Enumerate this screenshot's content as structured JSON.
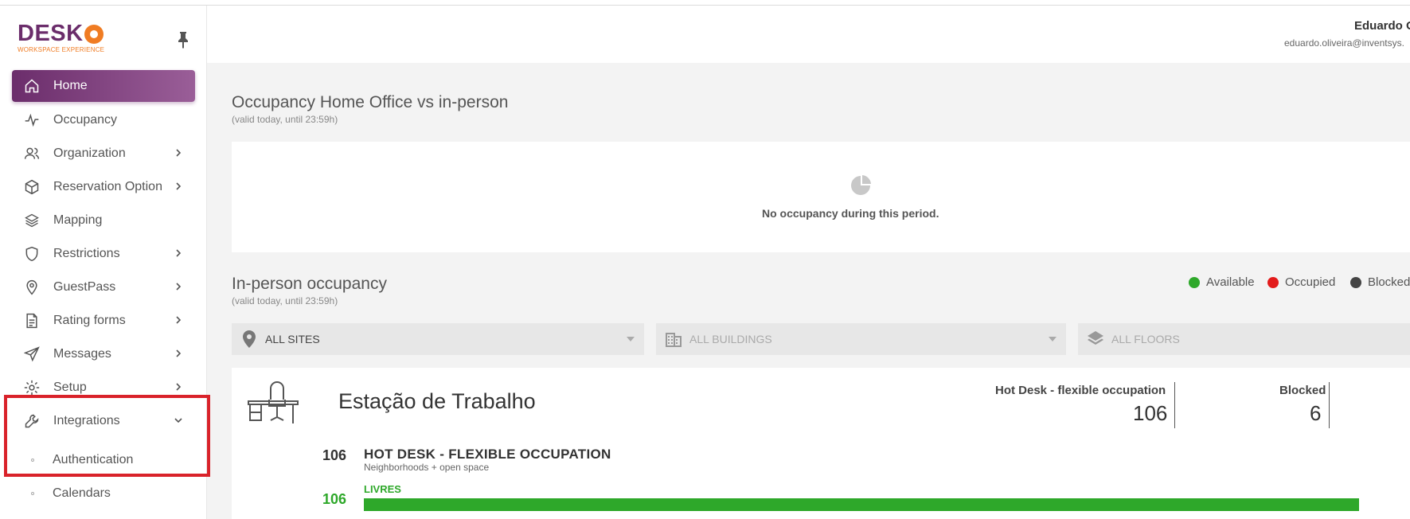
{
  "brand": {
    "name": "DESK",
    "tagline": "WORKSPACE EXPERIENCE",
    "primary": "#6b2d6b",
    "accent": "#f07c23"
  },
  "sidebar": {
    "items": [
      {
        "label": "Home",
        "icon": "home-icon",
        "active": true,
        "chevron": false
      },
      {
        "label": "Occupancy",
        "icon": "pulse-icon",
        "chevron": false
      },
      {
        "label": "Organization",
        "icon": "users-icon",
        "chevron": true
      },
      {
        "label": "Reservation Option",
        "icon": "cube-icon",
        "chevron": true
      },
      {
        "label": "Mapping",
        "icon": "layers-icon",
        "chevron": false
      },
      {
        "label": "Restrictions",
        "icon": "shield-icon",
        "chevron": true
      },
      {
        "label": "GuestPass",
        "icon": "location-pin-icon",
        "chevron": true
      },
      {
        "label": "Rating forms",
        "icon": "document-icon",
        "chevron": true
      },
      {
        "label": "Messages",
        "icon": "send-icon",
        "chevron": true
      },
      {
        "label": "Setup",
        "icon": "gear-icon",
        "chevron": true
      },
      {
        "label": "Integrations",
        "icon": "wrench-icon",
        "chevron": true,
        "expanded": true
      }
    ],
    "subitems": [
      {
        "label": "Authentication"
      },
      {
        "label": "Calendars"
      }
    ]
  },
  "header": {
    "user_name": "Eduardo O",
    "user_email": "eduardo.oliveira@inventsys."
  },
  "occupancy_section": {
    "title": "Occupancy Home Office vs in-person",
    "subtitle": "(valid today, until 23:59h)",
    "empty_message": "No occupancy during this period."
  },
  "inperson_section": {
    "title": "In-person occupancy",
    "subtitle": "(valid today, until 23:59h)",
    "legend": [
      {
        "label": "Available",
        "color": "#2ea82a"
      },
      {
        "label": "Occupied",
        "color": "#e31b1b"
      },
      {
        "label": "Blocked",
        "color": "#444444"
      }
    ],
    "filters": {
      "sites": "ALL SITES",
      "buildings": "ALL BUILDINGS",
      "floors": "ALL FLOORS"
    }
  },
  "workstation": {
    "title": "Estação de Trabalho",
    "stats": [
      {
        "label": "Hot Desk - flexible occupation",
        "value": "106"
      },
      {
        "label": "Blocked",
        "value": "6"
      }
    ],
    "row": {
      "count": "106",
      "title": "HOT DESK - FLEXIBLE OCCUPATION",
      "subtitle": "Neighborhoods + open space",
      "free_label": "LIVRES",
      "free_count": "106",
      "free_fraction": 1.0
    }
  }
}
